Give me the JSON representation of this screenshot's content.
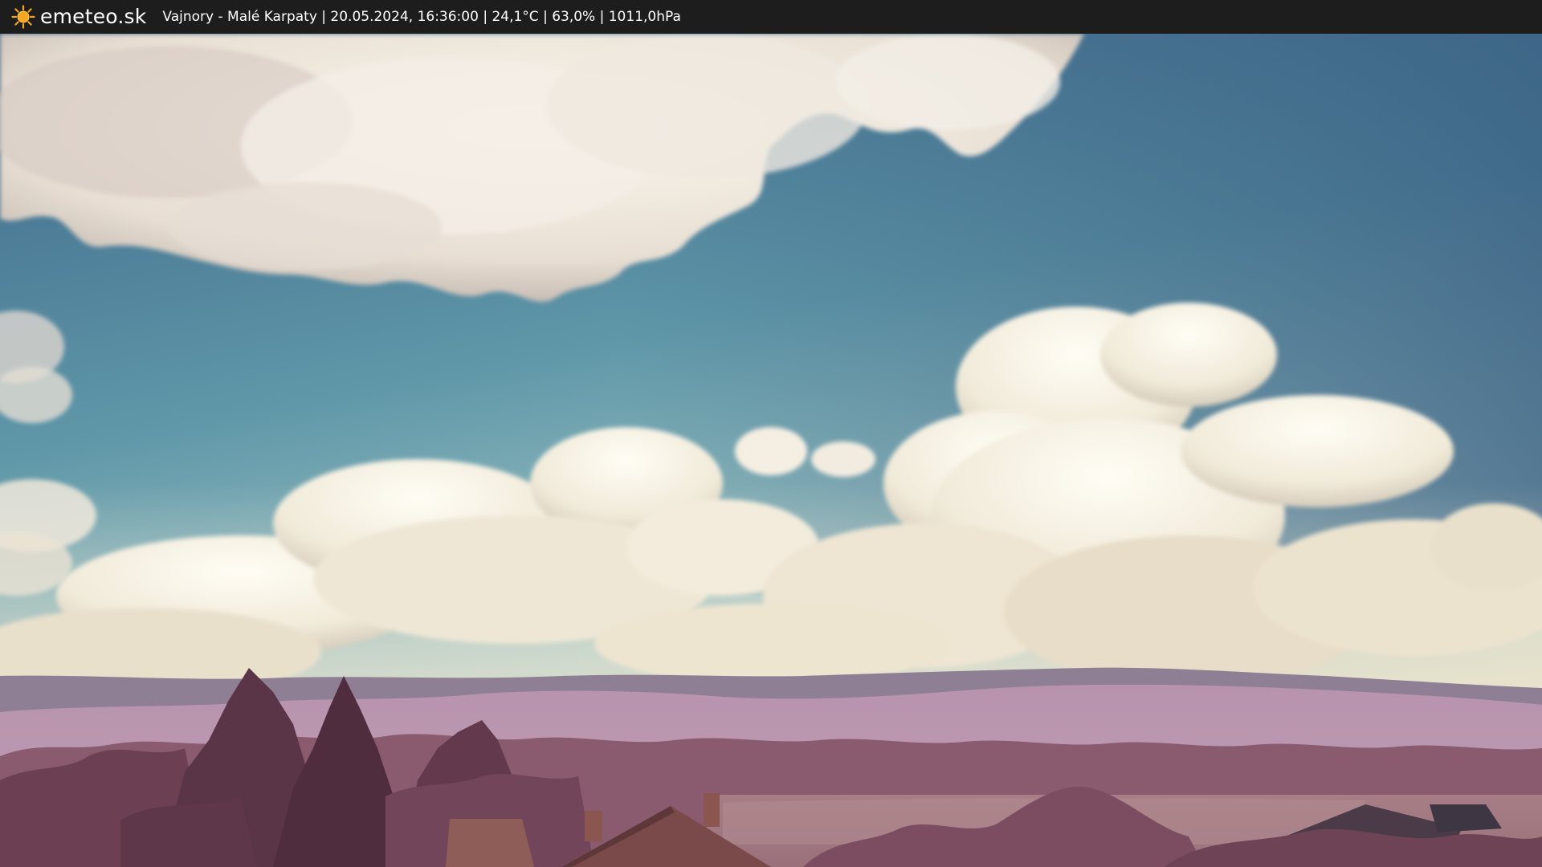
{
  "header": {
    "logo_text": "emeteo.sk",
    "logo_icon": "sun-icon",
    "caption": "Vajnory - Malé Karpaty | 20.05.2024, 16:36:00 | 24,1°C | 63,0% | 1011,0hPa"
  },
  "colors": {
    "bar_background": "#1d1d1d",
    "sun": "#f5a623",
    "sky_top": "#3f6b8e",
    "sky_bottom": "#9fc3c6",
    "hills": "#b48aa8",
    "trees": "#6e3e52"
  }
}
